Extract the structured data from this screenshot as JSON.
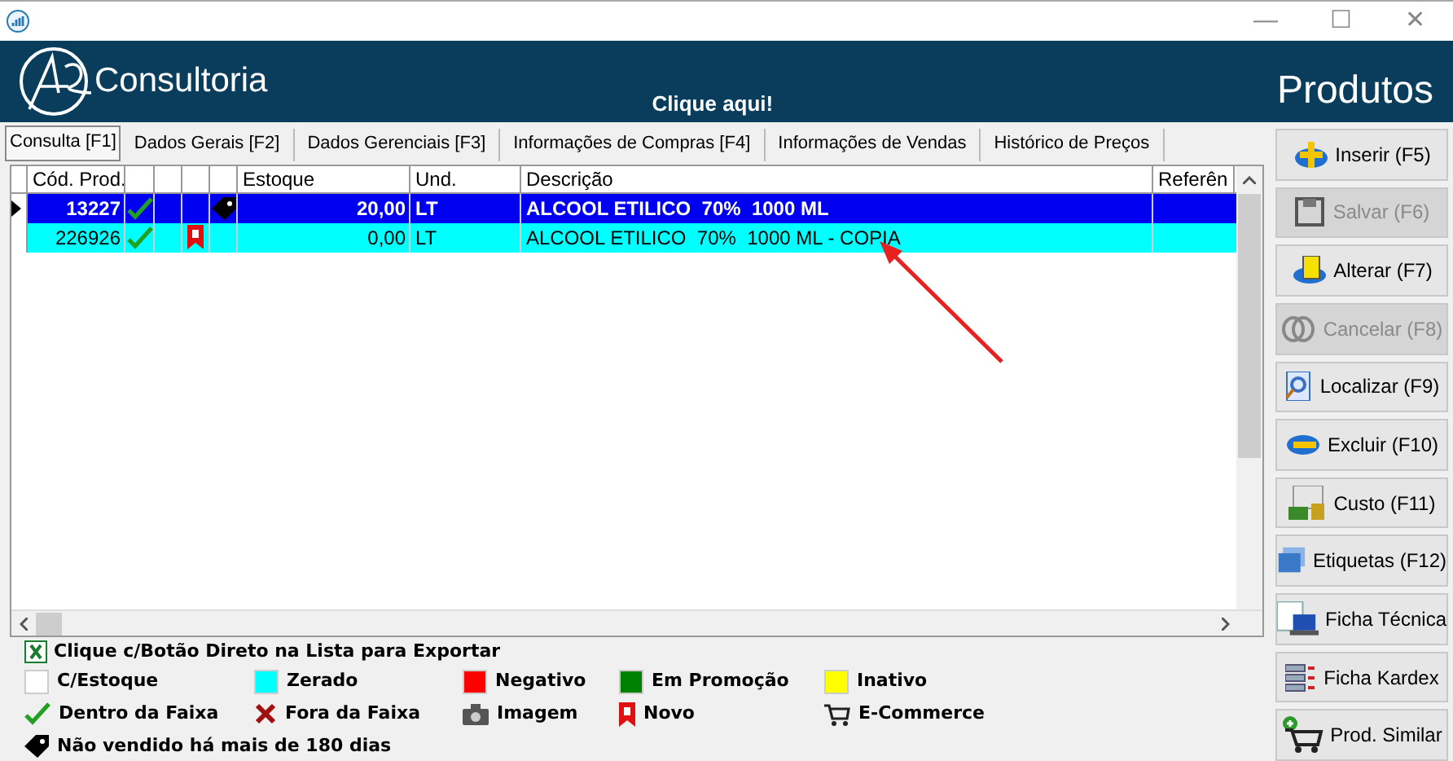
{
  "window": {
    "title_bar_buttons": [
      "—",
      "☐",
      "✕"
    ]
  },
  "header": {
    "brand": "Consultoria",
    "link": "Clique aqui!",
    "title": "Produtos"
  },
  "tabs": [
    {
      "label": "Consulta [F1]",
      "selected": true
    },
    {
      "label": "Dados Gerais [F2]",
      "selected": false
    },
    {
      "label": "Dados Gerenciais [F3]",
      "selected": false
    },
    {
      "label": "Informações de Compras [F4]",
      "selected": false
    },
    {
      "label": "Informações de Vendas",
      "selected": false
    },
    {
      "label": "Histórico de Preços",
      "selected": false
    }
  ],
  "table": {
    "columns": [
      "Cód. Prod.",
      "",
      "",
      "",
      "",
      "Estoque",
      "Und.",
      "Descrição",
      "Referên"
    ],
    "rows": [
      {
        "selected": true,
        "code": "13227",
        "in_range": true,
        "new": false,
        "tagged": true,
        "stock": "20,00",
        "unit": "LT",
        "description": "ALCOOL ETILICO  70%  1000 ML"
      },
      {
        "selected": false,
        "color": "#00ffff",
        "code": "226926",
        "in_range": true,
        "new": true,
        "tagged": false,
        "stock": "0,00",
        "unit": "LT",
        "description": "ALCOOL ETILICO  70%  1000 ML - COPIA"
      }
    ]
  },
  "export_hint": "Clique c/Botão Direto na Lista para Exportar",
  "legend": [
    {
      "kind": "swatch",
      "color": "#ffffff",
      "label": "C/Estoque"
    },
    {
      "kind": "swatch",
      "color": "#00ffff",
      "label": "Zerado"
    },
    {
      "kind": "swatch",
      "color": "#ff0000",
      "label": "Negativo"
    },
    {
      "kind": "swatch",
      "color": "#008000",
      "label": "Em Promoção"
    },
    {
      "kind": "swatch",
      "color": "#ffff00",
      "label": "Inativo"
    },
    {
      "kind": "check",
      "label": "Dentro da Faixa"
    },
    {
      "kind": "cross",
      "label": "Fora da Faixa"
    },
    {
      "kind": "camera",
      "label": "Imagem"
    },
    {
      "kind": "ribbon",
      "label": "Novo"
    },
    {
      "kind": "cart",
      "label": "E-Commerce"
    },
    {
      "kind": "tag",
      "label": "Não vendido há mais de 180 dias"
    }
  ],
  "buttons": [
    {
      "label": "Inserir (F5)",
      "disabled": false
    },
    {
      "label": "Salvar (F6)",
      "disabled": true
    },
    {
      "label": "Alterar (F7)",
      "disabled": false
    },
    {
      "label": "Cancelar (F8)",
      "disabled": true
    },
    {
      "label": "Localizar (F9)",
      "disabled": false
    },
    {
      "label": "Excluir (F10)",
      "disabled": false
    },
    {
      "label": "Custo (F11)",
      "disabled": false
    },
    {
      "label": "Etiquetas (F12)",
      "disabled": false
    },
    {
      "label": "Ficha Técnica",
      "disabled": false
    },
    {
      "label": "Ficha Kardex",
      "disabled": false
    },
    {
      "label": "Prod. Similar",
      "disabled": false
    }
  ]
}
